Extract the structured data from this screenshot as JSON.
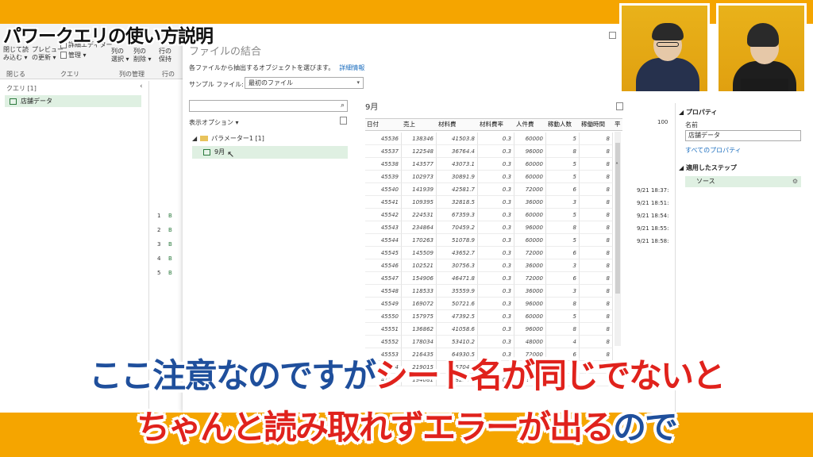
{
  "video_title": "パワークエリの使い方説明",
  "ribbon": {
    "close_load": "閉じて読\nみ込む ▾",
    "preview_refresh": "プレビュー\nの更新 ▾",
    "advanced_editor": "詳細エディター",
    "manage": "管理 ▾",
    "col_select": "列の\n選択 ▾",
    "col_remove": "列の\n削除 ▾",
    "row_keep": "行の\n保持",
    "groups": [
      "閉じる",
      "クエリ",
      "列の管理",
      "行の"
    ]
  },
  "query_pane": {
    "title": "クエリ [1]",
    "item": "店舗データ"
  },
  "background_grid": {
    "row_numbers": [
      "1",
      "2",
      "3",
      "4",
      "5"
    ],
    "row_prefix": "B"
  },
  "dialog": {
    "title": "ファイルの結合",
    "subtitle": "各ファイルから抽出するオブジェクトを選びます。",
    "detail_link": "詳細情報",
    "sample_file_label": "サンプル ファイル:",
    "sample_file_value": "最初のファイル",
    "display_options": "表示オプション ▾",
    "tree_folder": "パラメーター1 [1]",
    "tree_sheet": "9月"
  },
  "preview": {
    "title": "9月",
    "columns": [
      "日付",
      "売上",
      "材料費",
      "材料費率",
      "人件費",
      "稼動人数",
      "稼働時間",
      "平"
    ],
    "rows": [
      [
        "45536",
        "138346",
        "41503.8",
        "0.3",
        "60000",
        "5",
        "8"
      ],
      [
        "45537",
        "122548",
        "36764.4",
        "0.3",
        "96000",
        "8",
        "8"
      ],
      [
        "45538",
        "143577",
        "43073.1",
        "0.3",
        "60000",
        "5",
        "8"
      ],
      [
        "45539",
        "102973",
        "30891.9",
        "0.3",
        "60000",
        "5",
        "8"
      ],
      [
        "45540",
        "141939",
        "42581.7",
        "0.3",
        "72000",
        "6",
        "8"
      ],
      [
        "45541",
        "109395",
        "32818.5",
        "0.3",
        "36000",
        "3",
        "8"
      ],
      [
        "45542",
        "224531",
        "67359.3",
        "0.3",
        "60000",
        "5",
        "8"
      ],
      [
        "45543",
        "234864",
        "70459.2",
        "0.3",
        "96000",
        "8",
        "8"
      ],
      [
        "45544",
        "170263",
        "51078.9",
        "0.3",
        "60000",
        "5",
        "8"
      ],
      [
        "45545",
        "145509",
        "43652.7",
        "0.3",
        "72000",
        "6",
        "8"
      ],
      [
        "45546",
        "102521",
        "30756.3",
        "0.3",
        "36000",
        "3",
        "8"
      ],
      [
        "45547",
        "154906",
        "46471.8",
        "0.3",
        "72000",
        "6",
        "8"
      ],
      [
        "45548",
        "118533",
        "35559.9",
        "0.3",
        "36000",
        "3",
        "8"
      ],
      [
        "45549",
        "169072",
        "50721.6",
        "0.3",
        "96000",
        "8",
        "8"
      ],
      [
        "45550",
        "157975",
        "47392.5",
        "0.3",
        "60000",
        "5",
        "8"
      ],
      [
        "45551",
        "136862",
        "41058.6",
        "0.3",
        "96000",
        "8",
        "8"
      ],
      [
        "45552",
        "178034",
        "53410.2",
        "0.3",
        "48000",
        "4",
        "8"
      ],
      [
        "45553",
        "216435",
        "64930.5",
        "0.3",
        "72000",
        "6",
        "8"
      ],
      [
        "45554",
        "219015",
        "65704.5",
        "0.3",
        "96000",
        "8",
        "8"
      ],
      [
        "45555",
        "194081",
        "58224.3",
        "0.3",
        "84000",
        "7",
        "8"
      ]
    ]
  },
  "right_values": [
    "100",
    "9/21 18:37:",
    "9/21 18:51:",
    "9/21 18:54:",
    "9/21 18:55:",
    "9/21 18:58:"
  ],
  "properties": {
    "header": "◢ プロパティ",
    "name_label": "名前",
    "name_value": "店舗データ",
    "all_props": "すべてのプロパティ",
    "steps_header": "◢ 適用したステップ",
    "step_source": "ソース"
  },
  "subtitles": {
    "line1_blue": "ここ注意なのですが",
    "line1_red": "シート名が同じでないと",
    "line2_red": "ちゃんと読み取れずエラーが出る",
    "line2_blue": "ので"
  },
  "colors": {
    "frame": "#f5a500",
    "accent_green": "#dff0e2",
    "sub_blue": "#1f4f9c",
    "sub_red": "#e0221c"
  }
}
